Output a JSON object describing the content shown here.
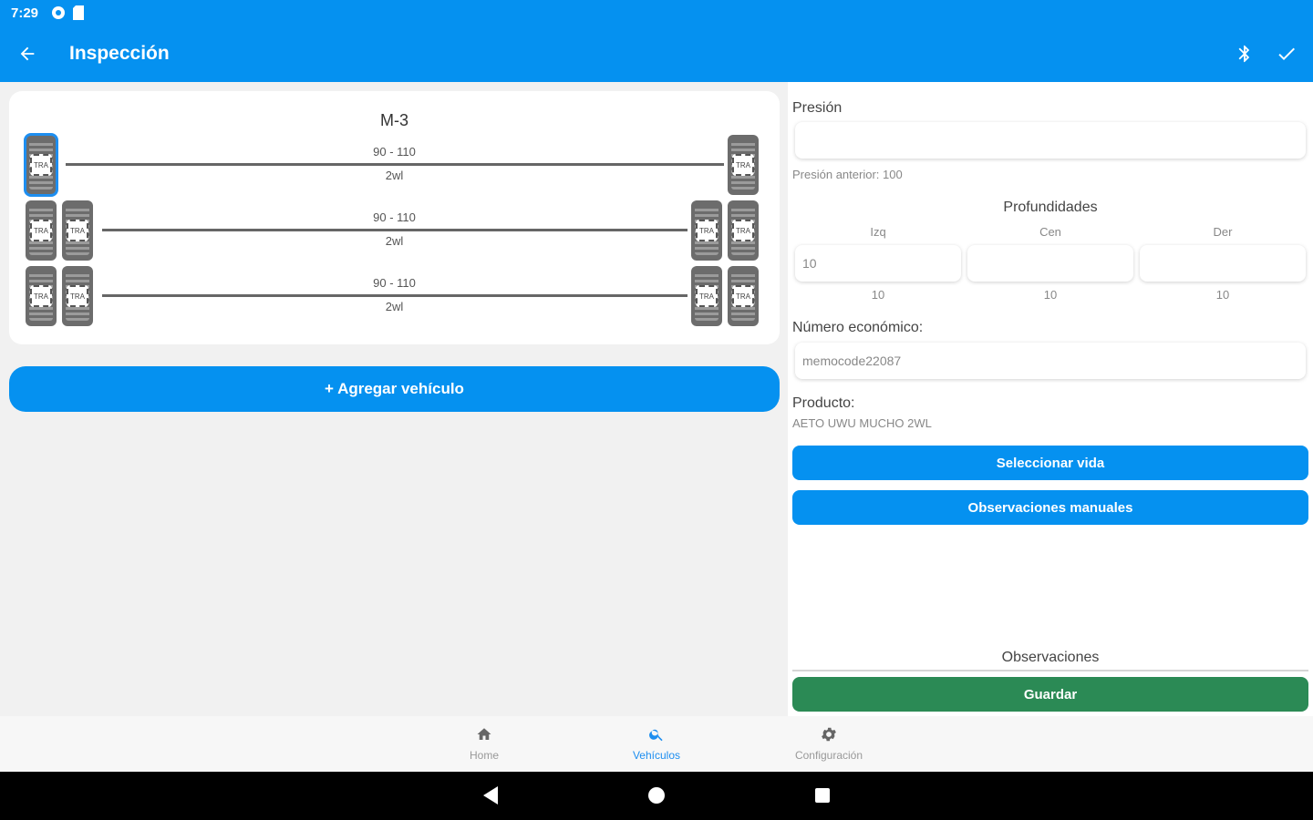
{
  "status": {
    "time": "7:29"
  },
  "appbar": {
    "title": "Inspección",
    "icons": [
      "back-arrow-icon",
      "bluetooth-icon",
      "check-icon"
    ]
  },
  "vehicle": {
    "name": "M-3",
    "axles": [
      {
        "range": "90 - 110",
        "config": "2wl"
      },
      {
        "range": "90 - 110",
        "config": "2wl"
      },
      {
        "range": "90 - 110",
        "config": "2wl"
      }
    ],
    "add_label": "+ Agregar vehículo"
  },
  "form": {
    "pressure_label": "Presión",
    "pressure_value": "",
    "previous_pressure": "Presión anterior: 100",
    "depths_title": "Profundidades",
    "depth_cols": [
      "Izq",
      "Cen",
      "Der"
    ],
    "depth_values": [
      "10",
      "",
      ""
    ],
    "depth_previous": [
      "10",
      "10",
      "10"
    ],
    "econ_label": "Número económico:",
    "econ_value": "memocode22087",
    "product_label": "Producto:",
    "product_value": "AETO UWU MUCHO 2WL",
    "select_life": "Seleccionar vida",
    "manual_obs": "Observaciones manuales",
    "observations_label": "Observaciones",
    "save": "Guardar"
  },
  "nav": {
    "items": [
      {
        "label": "Home",
        "icon": "home-icon"
      },
      {
        "label": "Vehículos",
        "icon": "search-icon",
        "active": true
      },
      {
        "label": "Configuración",
        "icon": "gear-icon"
      }
    ]
  },
  "colors": {
    "primary": "#0591f0",
    "save": "#2b8a55"
  }
}
